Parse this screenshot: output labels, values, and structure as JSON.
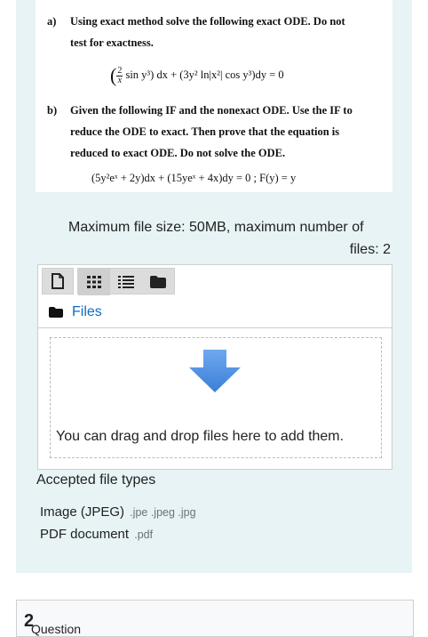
{
  "question": {
    "a_label": "a)",
    "a_line1": "Using exact method solve the following exact ODE. Do not",
    "a_line2": "test for exactness.",
    "a_equation": {
      "frac_num": "2",
      "frac_den": "x",
      "rest": "sin y³) dx + (3y² ln|x²| cos y³)dy = 0"
    },
    "b_label": "b)",
    "b_line1": "Given the following IF and the nonexact ODE. Use the IF to",
    "b_line2": "reduce the ODE to exact. Then prove that the equation is",
    "b_line3": "reduced to exact ODE. Do not solve the ODE.",
    "b_equation": "(5y²eˣ + 2y)dx + (15yeˣ + 4x)dy = 0   ;   F(y) = y"
  },
  "upload": {
    "limits_line1": "Maximum file size: 50MB, maximum number of",
    "limits_line2": "files: 2",
    "toolbar_icons": [
      "file-add-icon",
      "grid-view-icon",
      "list-view-icon",
      "folder-view-icon"
    ],
    "files_label": "Files",
    "drop_text": "You can drag and drop files here to add them.",
    "arrow_color": "#4a90e2"
  },
  "accepted": {
    "title": "Accepted file types",
    "types": [
      {
        "name": "Image (JPEG)",
        "ext": ".jpe .jpeg .jpg"
      },
      {
        "name": "PDF document",
        "ext": ".pdf"
      }
    ]
  },
  "next_question": {
    "label": "Question",
    "number": "2"
  }
}
